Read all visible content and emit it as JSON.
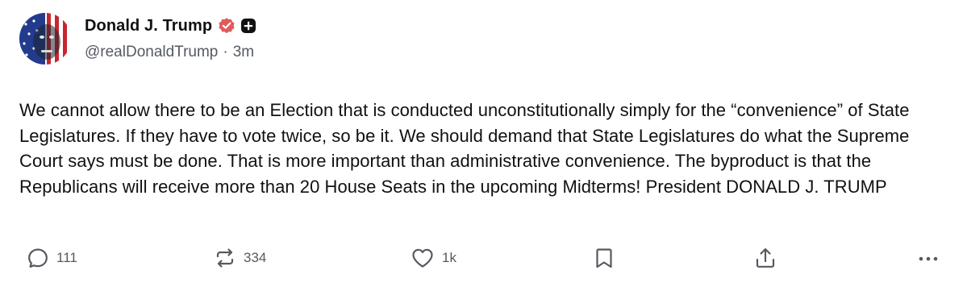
{
  "author": {
    "display_name": "Donald J. Trump",
    "handle": "@realDonaldTrump",
    "separator": "·",
    "time_ago": "3m",
    "verified_color": "#e15a5a"
  },
  "post": {
    "text": "We cannot allow there to be an Election that is conducted unconstitutionally simply for the “convenience” of State Legislatures. If they have to vote twice, so be it. We should demand that State Legislatures do what the Supreme Court says must be done. That is more important than administrative convenience. The byproduct is that the Republicans will receive more than 20 House Seats in the upcoming Midterms! President DONALD J. TRUMP"
  },
  "actions": {
    "reply": {
      "icon": "reply-icon",
      "count": "111"
    },
    "repost": {
      "icon": "repost-icon",
      "count": "334"
    },
    "like": {
      "icon": "heart-icon",
      "count": "1k"
    },
    "bookmark": {
      "icon": "bookmark-icon"
    },
    "share": {
      "icon": "share-icon"
    },
    "more": {
      "icon": "more-icon"
    }
  },
  "colors": {
    "text": "#111111",
    "muted": "#555a61",
    "background": "#ffffff"
  }
}
